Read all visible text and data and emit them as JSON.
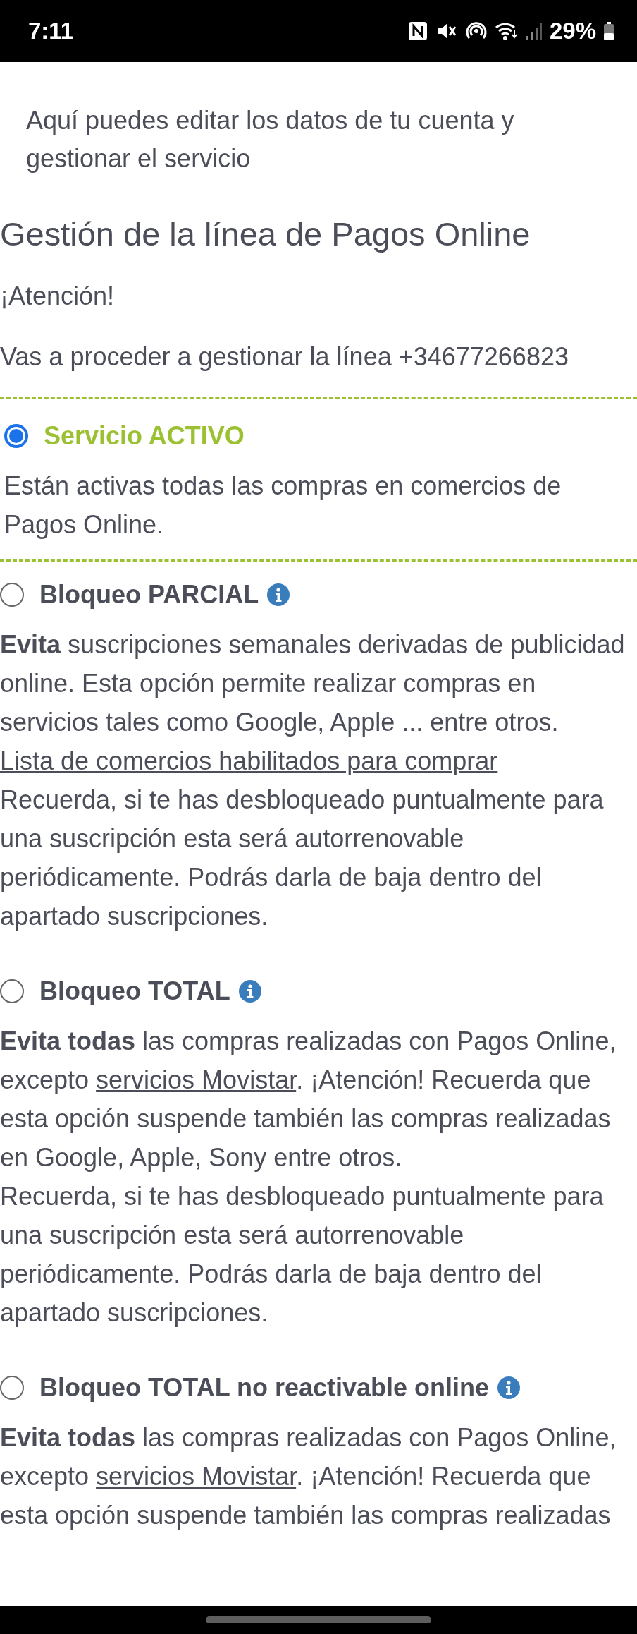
{
  "status_bar": {
    "time": "7:11",
    "battery": "29%"
  },
  "intro": "Aquí puedes editar los datos de tu cuenta y gestionar el servicio",
  "heading": "Gestión de la línea de Pagos Online",
  "notice": "¡Atención!",
  "line_message": "Vas a proceder a gestionar la línea +34677266823",
  "options": [
    {
      "title": "Servicio ACTIVO",
      "selected": true,
      "info": false,
      "paragraphs": [
        [
          {
            "kind": "text",
            "text": "Están activas todas las compras en comercios de Pagos Online."
          }
        ]
      ]
    },
    {
      "title": "Bloqueo PARCIAL",
      "selected": false,
      "info": true,
      "paragraphs": [
        [
          {
            "kind": "text",
            "text": "**Evita** suscripciones semanales derivadas de publicidad online. Esta opción permite realizar compras en servicios tales como Google, Apple ... entre otros."
          }
        ],
        [
          {
            "kind": "link",
            "text": "Lista de comercios habilitados para comprar"
          }
        ],
        [
          {
            "kind": "text",
            "text": "Recuerda, si te has desbloqueado puntualmente para una suscripción esta será autorrenovable periódicamente. Podrás darla de baja dentro del apartado suscripciones."
          }
        ]
      ]
    },
    {
      "title": "Bloqueo TOTAL",
      "selected": false,
      "info": true,
      "paragraphs": [
        [
          {
            "kind": "text",
            "text": "**Evita todas** las compras realizadas con Pagos Online, excepto "
          },
          {
            "kind": "link",
            "text": "servicios Movistar"
          },
          {
            "kind": "text",
            "text": ". ¡Atención! Recuerda que esta opción suspende también las compras realizadas en Google, Apple, Sony entre otros."
          }
        ],
        [
          {
            "kind": "text",
            "text": "Recuerda, si te has desbloqueado puntualmente para una suscripción esta será autorrenovable periódicamente. Podrás darla de baja dentro del apartado suscripciones."
          }
        ]
      ]
    },
    {
      "title": "Bloqueo TOTAL no reactivable online",
      "selected": false,
      "info": true,
      "paragraphs": [
        [
          {
            "kind": "text",
            "text": "**Evita todas** las compras realizadas con Pagos Online, excepto "
          },
          {
            "kind": "link",
            "text": "servicios Movistar"
          },
          {
            "kind": "text",
            "text": ". ¡Atención! Recuerda que esta opción suspende también las compras realizadas"
          }
        ]
      ]
    }
  ]
}
